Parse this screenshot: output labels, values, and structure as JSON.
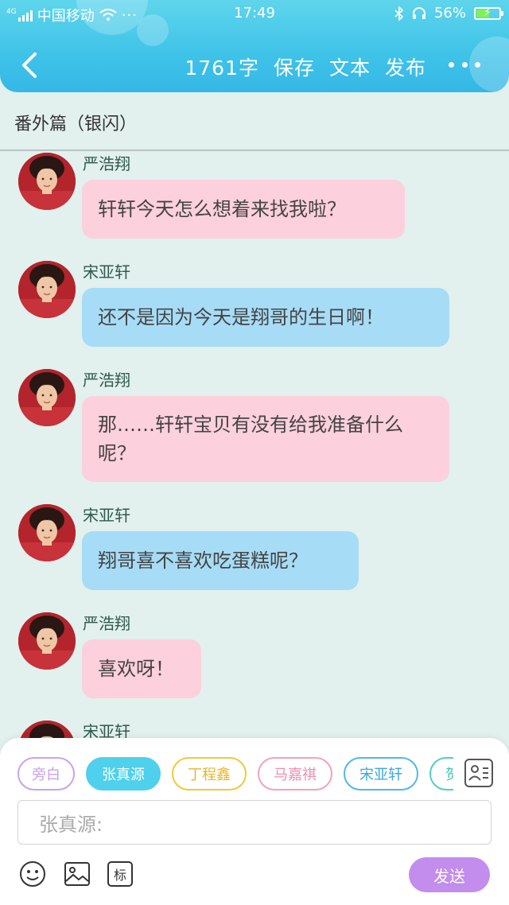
{
  "status_bar": {
    "network": "4G",
    "carrier": "中国移动",
    "time": "17:49",
    "battery": "56%",
    "battery_level": 0.56
  },
  "header": {
    "word_count": "1761字",
    "actions": [
      "保存",
      "文本",
      "发布"
    ]
  },
  "story_title": "番外篇（银闪）",
  "messages": [
    {
      "speaker": "严浩翔",
      "text": "轩轩今天怎么想着来找我啦？",
      "color": "pink"
    },
    {
      "speaker": "宋亚轩",
      "text": "还不是因为今天是翔哥的生日啊！",
      "color": "blue"
    },
    {
      "speaker": "严浩翔",
      "text": "那……轩轩宝贝有没有给我准备什么呢？",
      "color": "pink"
    },
    {
      "speaker": "宋亚轩",
      "text": "翔哥喜不喜欢吃蛋糕呢？",
      "color": "blue"
    },
    {
      "speaker": "严浩翔",
      "text": "喜欢呀！",
      "color": "pink"
    },
    {
      "speaker": "宋亚轩",
      "text": "",
      "color": "blue"
    }
  ],
  "characters": [
    {
      "label": "旁白",
      "color": "#c9a3ea"
    },
    {
      "label": "张真源",
      "color": "#4fd0ec",
      "selected": true
    },
    {
      "label": "丁程鑫",
      "color": "#f0c93a"
    },
    {
      "label": "马嘉祺",
      "color": "#f0a4bb"
    },
    {
      "label": "宋亚轩",
      "color": "#52b8e8"
    },
    {
      "label": "贺",
      "color": "#4fd0c0"
    }
  ],
  "input": {
    "placeholder": "张真源:"
  },
  "toolbar": {
    "mark_label": "标",
    "send_label": "发送"
  },
  "colors": {
    "header": "#3ec3e8",
    "pink_bubble": "#fcd0dc",
    "blue_bubble": "#a7dcf6",
    "send": "#c28ded",
    "background": "#e2f0ee"
  }
}
